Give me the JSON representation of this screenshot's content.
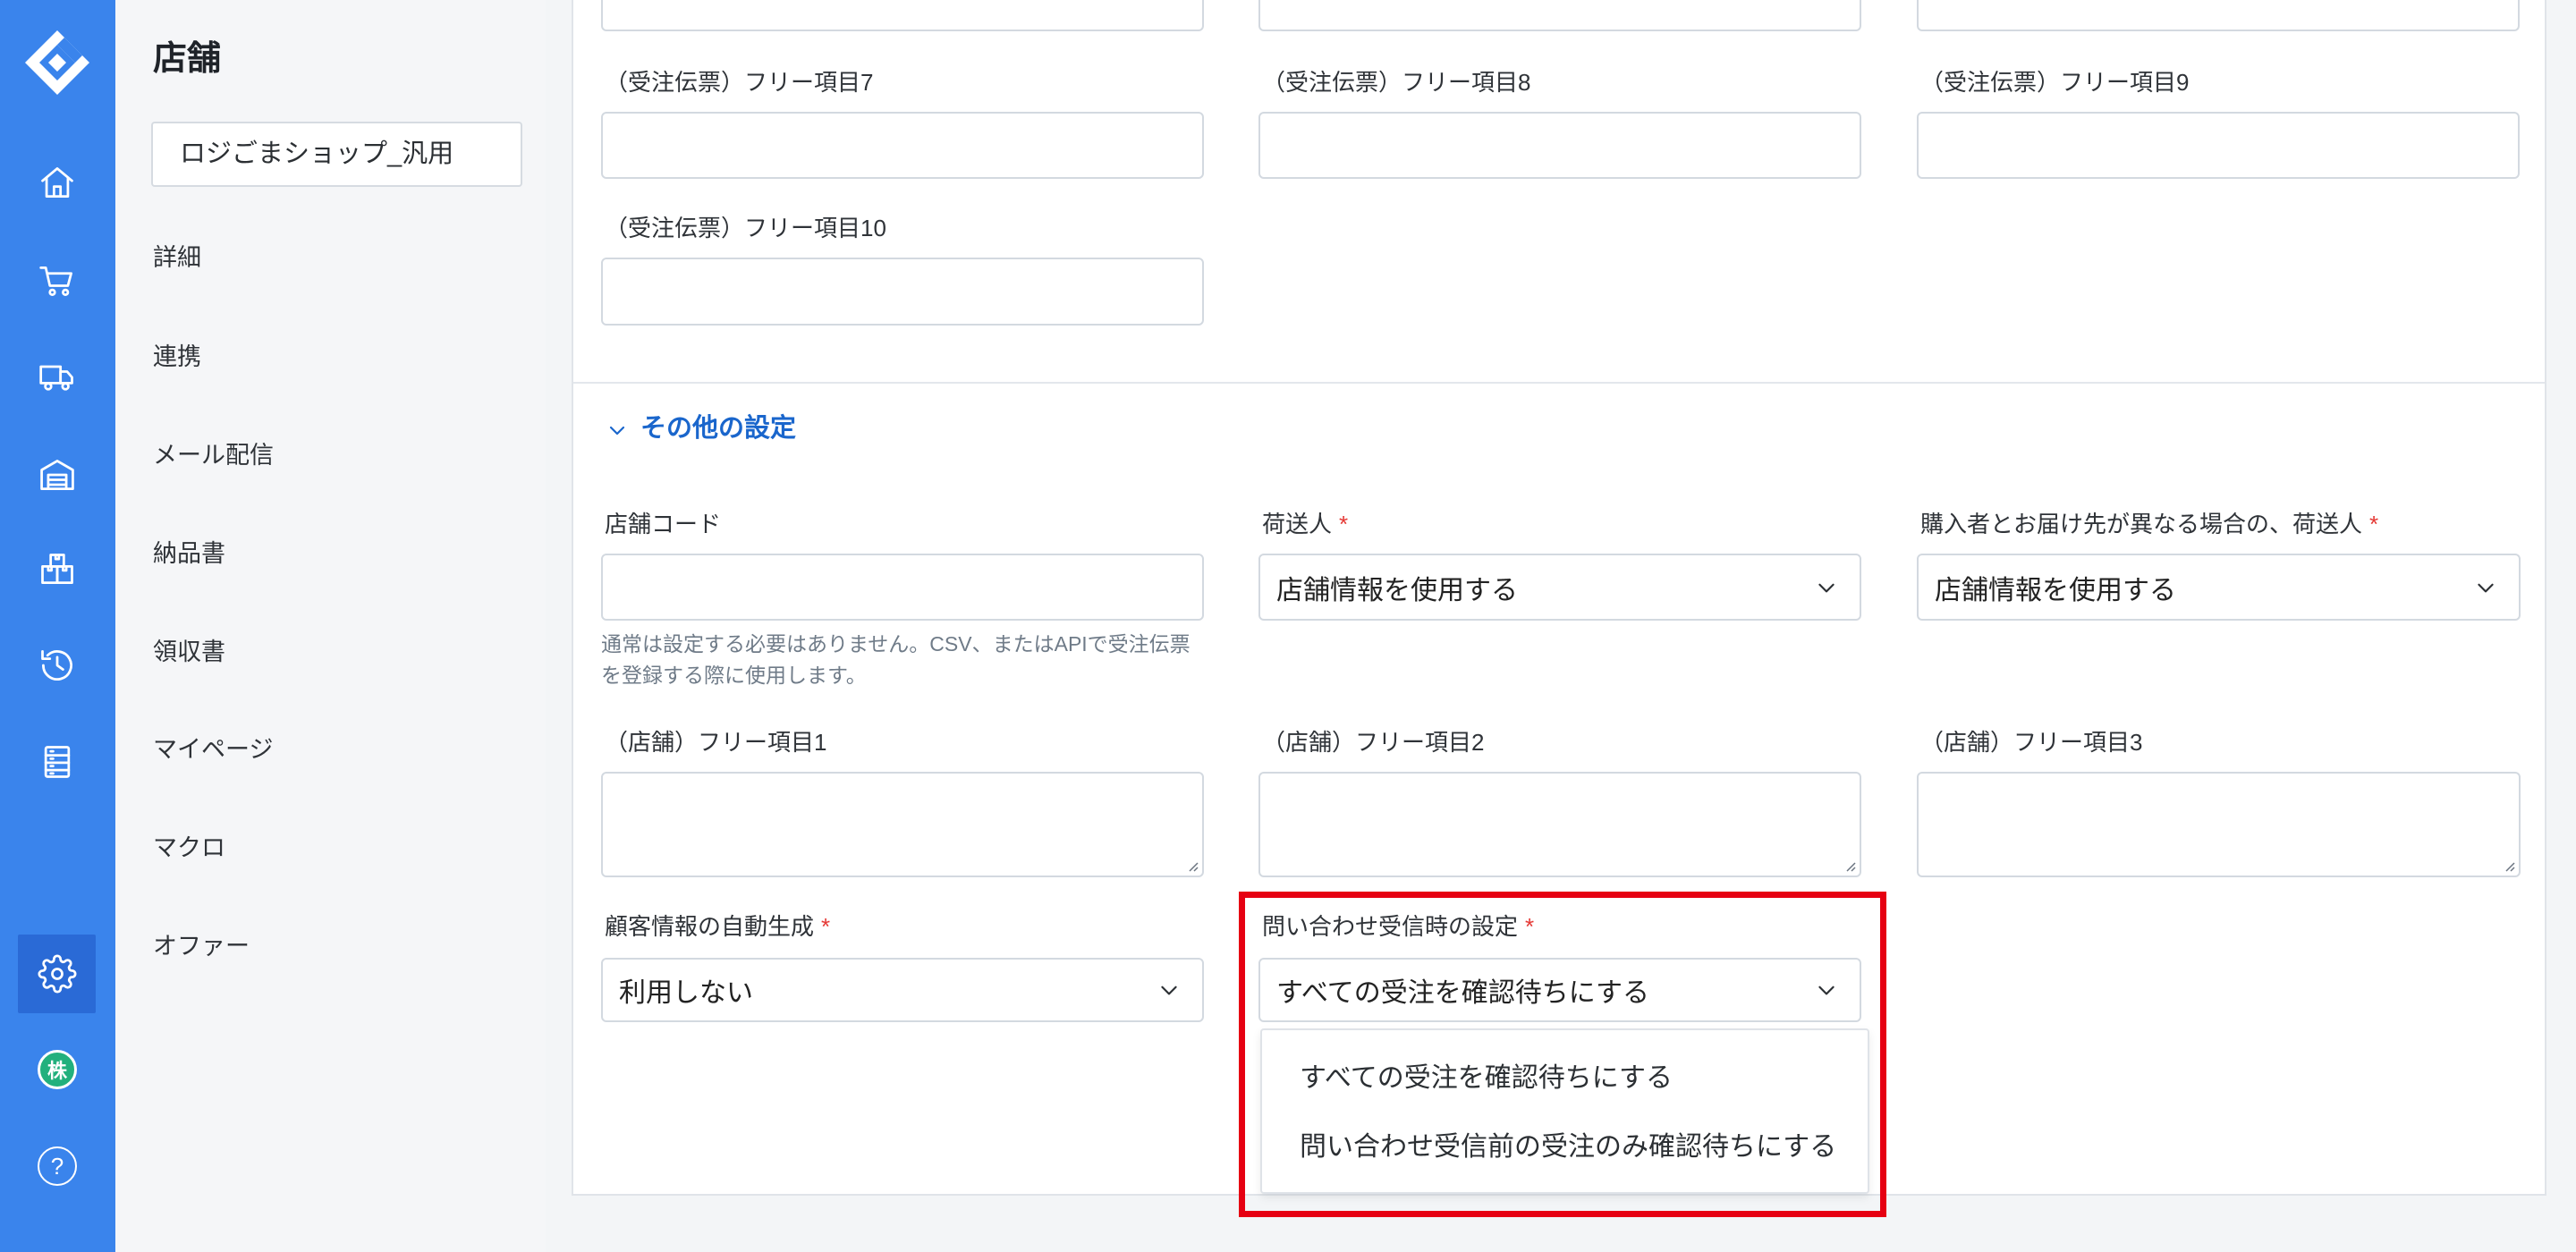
{
  "rail": {
    "logo": "logo-icon",
    "nav_icons": [
      "home-icon",
      "cart-icon",
      "truck-icon",
      "warehouse-icon",
      "boxes-icon",
      "history-icon",
      "list-icon",
      "gear-icon"
    ],
    "active_icon": "gear-icon",
    "avatar_label": "株",
    "help_label": "?"
  },
  "sidebar": {
    "title": "店舗",
    "shop_name": "ロジごまショップ_汎用",
    "items": [
      "詳細",
      "連携",
      "メール配信",
      "納品書",
      "領収書",
      "マイページ",
      "マクロ",
      "オファー"
    ]
  },
  "form": {
    "order_free_fields": [
      {
        "label": "（受注伝票）フリー項目7"
      },
      {
        "label": "（受注伝票）フリー項目8"
      },
      {
        "label": "（受注伝票）フリー項目9"
      },
      {
        "label": "（受注伝票）フリー項目10"
      }
    ],
    "section_title": "その他の設定",
    "store_code": {
      "label": "店舗コード",
      "help": "通常は設定する必要はありません。CSV、またはAPIで受注伝票を登録する際に使用します。"
    },
    "shipper": {
      "label": "荷送人",
      "required": "*",
      "value": "店舗情報を使用する"
    },
    "alt_shipper": {
      "label": "購入者とお届け先が異なる場合の、荷送人",
      "required": "*",
      "value": "店舗情報を使用する"
    },
    "store_free_fields": [
      {
        "label": "（店舗）フリー項目1"
      },
      {
        "label": "（店舗）フリー項目2"
      },
      {
        "label": "（店舗）フリー項目3"
      }
    ],
    "customer_autogen": {
      "label": "顧客情報の自動生成",
      "required": "*",
      "value": "利用しない"
    },
    "inquiry_setting": {
      "label": "問い合わせ受信時の設定",
      "required": "*",
      "value": "すべての受注を確認待ちにする",
      "options": [
        "すべての受注を確認待ちにする",
        "問い合わせ受信前の受注のみ確認待ちにする"
      ]
    }
  },
  "colors": {
    "rail": "#3a84ec",
    "rail_active": "#2a6ad6",
    "accent": "#1a66cc",
    "required": "#e53935",
    "highlight": "#e60012",
    "avatar": "#22b07d"
  }
}
